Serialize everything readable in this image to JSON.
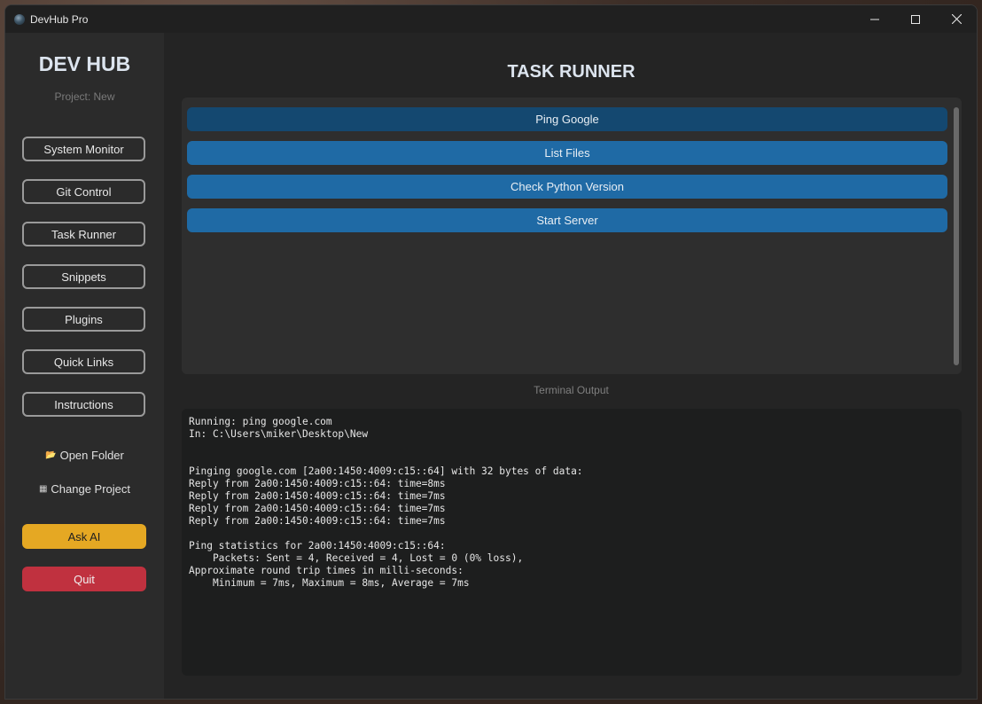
{
  "window": {
    "title": "DevHub Pro"
  },
  "sidebar": {
    "brand": "DEV HUB",
    "project": "Project: New",
    "nav": [
      {
        "label": "System Monitor"
      },
      {
        "label": "Git Control"
      },
      {
        "label": "Task Runner"
      },
      {
        "label": "Snippets"
      },
      {
        "label": "Plugins"
      },
      {
        "label": "Quick Links"
      },
      {
        "label": "Instructions"
      }
    ],
    "open_folder": "Open Folder",
    "change_project": "Change Project",
    "ask_ai": "Ask AI",
    "quit": "Quit"
  },
  "main": {
    "title": "TASK RUNNER",
    "tasks": [
      {
        "label": "Ping Google"
      },
      {
        "label": "List Files"
      },
      {
        "label": "Check Python Version"
      },
      {
        "label": "Start Server"
      }
    ],
    "terminal_label": "Terminal Output",
    "terminal_output": "Running: ping google.com\nIn: C:\\Users\\miker\\Desktop\\New\n\n\nPinging google.com [2a00:1450:4009:c15::64] with 32 bytes of data:\nReply from 2a00:1450:4009:c15::64: time=8ms\nReply from 2a00:1450:4009:c15::64: time=7ms\nReply from 2a00:1450:4009:c15::64: time=7ms\nReply from 2a00:1450:4009:c15::64: time=7ms\n\nPing statistics for 2a00:1450:4009:c15::64:\n    Packets: Sent = 4, Received = 4, Lost = 0 (0% loss),\nApproximate round trip times in milli-seconds:\n    Minimum = 7ms, Maximum = 8ms, Average = 7ms"
  },
  "colors": {
    "accent_blue": "#1f6aa5",
    "hover_blue": "#144870",
    "ask_ai": "#e5a823",
    "quit": "#c0313f"
  }
}
